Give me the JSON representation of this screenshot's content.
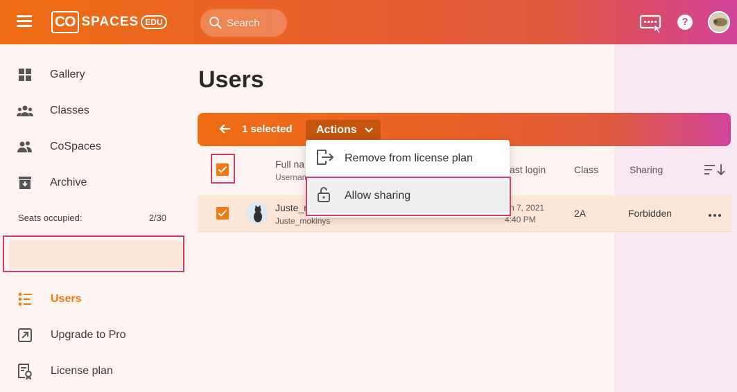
{
  "app": {
    "logo_co": "CO",
    "logo_spaces": "SPACES",
    "logo_edu": "EDU",
    "search_placeholder": "Search"
  },
  "sidebar": {
    "items": [
      {
        "label": "Gallery",
        "icon": "grid-icon"
      },
      {
        "label": "Classes",
        "icon": "group-icon"
      },
      {
        "label": "CoSpaces",
        "icon": "people-icon"
      },
      {
        "label": "Archive",
        "icon": "archive-icon"
      }
    ],
    "seats_label": "Seats occupied:",
    "seats_value": "2/30",
    "bottom_items": [
      {
        "label": "Users",
        "icon": "users-list-icon",
        "active": true
      },
      {
        "label": "Upgrade to Pro",
        "icon": "external-arrow-icon"
      },
      {
        "label": "License plan",
        "icon": "license-icon"
      }
    ]
  },
  "main": {
    "title": "Users",
    "selection": {
      "count_label": "1 selected",
      "actions_label": "Actions"
    },
    "table": {
      "headers": {
        "full_name": "Full na",
        "username": "Usernam",
        "last_login": "ast login",
        "class": "Class",
        "sharing": "Sharing"
      },
      "rows": [
        {
          "full_name": "Juste_m",
          "username": "Juste_mokinys",
          "last_login_date": "n 7, 2021",
          "last_login_time": "4:40 PM",
          "class": "2A",
          "sharing": "Forbidden",
          "checked": true
        }
      ]
    },
    "dropdown": {
      "items": [
        {
          "label": "Remove from license plan",
          "icon": "exit-icon"
        },
        {
          "label": "Allow sharing",
          "icon": "unlock-icon"
        }
      ]
    }
  },
  "colors": {
    "accent": "#ef6d12",
    "highlight_border": "#d6396a",
    "active_bg": "#fde6d8"
  }
}
